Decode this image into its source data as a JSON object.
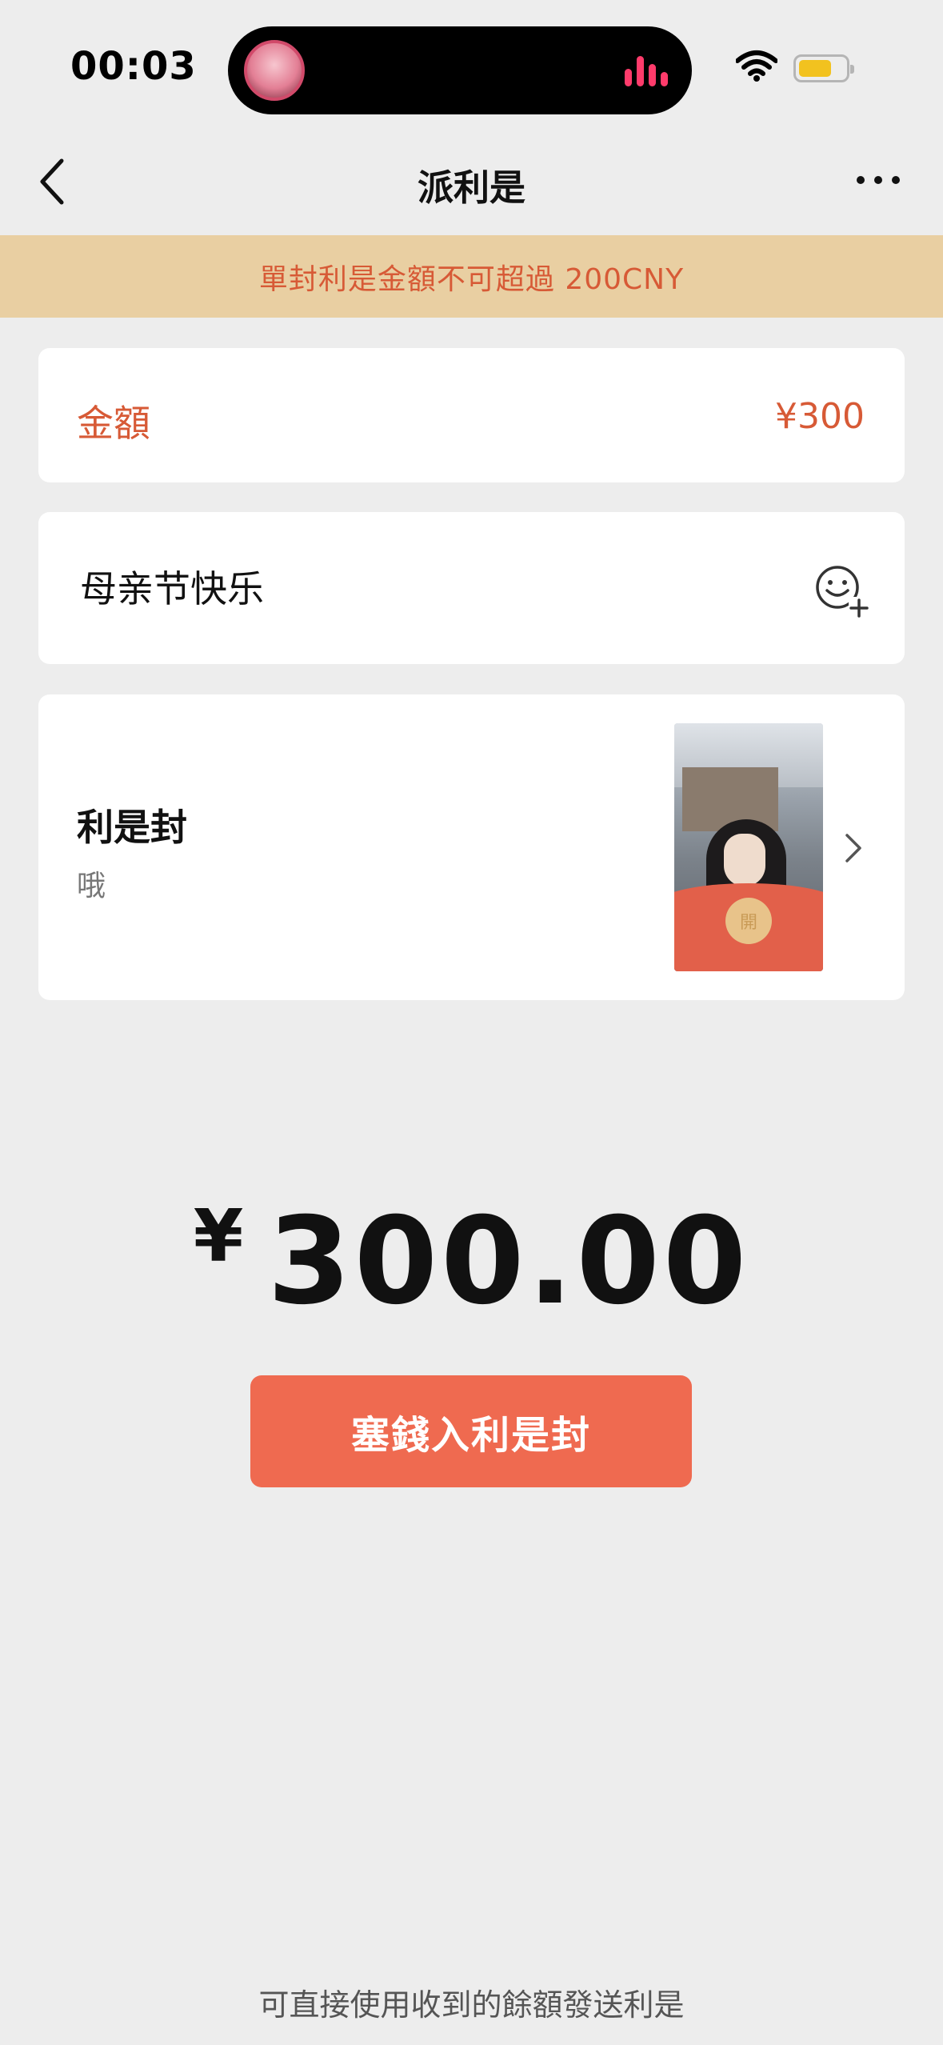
{
  "status_bar": {
    "time": "00:03"
  },
  "nav": {
    "title": "派利是"
  },
  "notice": {
    "text": "單封利是金額不可超過 200CNY"
  },
  "amount": {
    "label": "金額",
    "value": "¥300"
  },
  "message": {
    "text": "母亲节快乐"
  },
  "cover": {
    "title": "利是封",
    "subtitle": "哦",
    "seal_text": "開"
  },
  "total": {
    "currency": "¥",
    "value": "300.00"
  },
  "actions": {
    "send_label": "塞錢入利是封"
  },
  "footer": {
    "note": "可直接使用收到的餘額發送利是"
  },
  "colors": {
    "accent": "#ef6a50",
    "notice_bg": "#e9cfa2",
    "notice_text": "#d75a36",
    "background": "#ededed"
  }
}
